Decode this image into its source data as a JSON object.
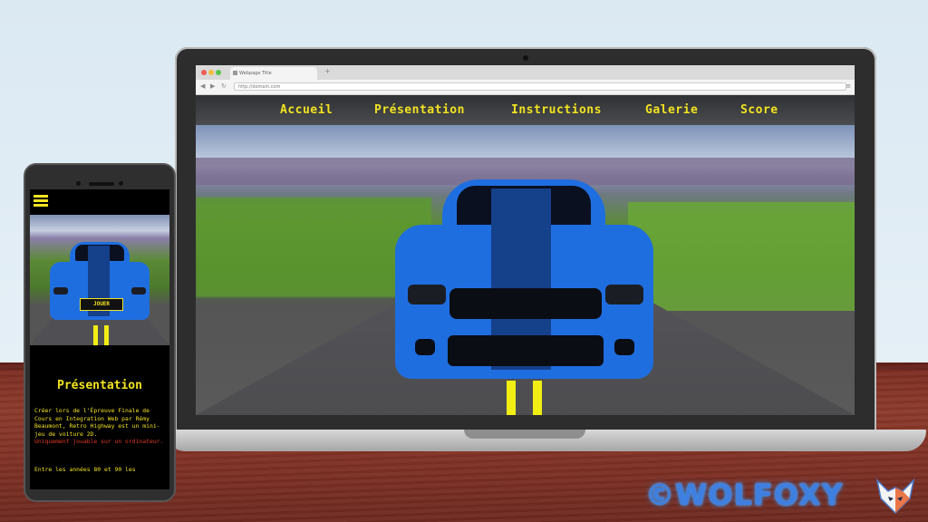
{
  "browser": {
    "tab_title": "Webpage Title",
    "new_tab": "+",
    "url": "http://domain.com",
    "back": "◀",
    "forward": "▶",
    "reload": "↻",
    "menu": "≡"
  },
  "site_nav": {
    "items": [
      {
        "label": "Accueil"
      },
      {
        "label": "Présentation"
      },
      {
        "label": "Instructions"
      },
      {
        "label": "Galerie"
      },
      {
        "label": "Score"
      }
    ],
    "color": "#f2e321"
  },
  "mobile": {
    "play_button": "JOUER",
    "section_title": "Présentation",
    "paragraph": "Créer lors de l'Épreuve Finale de Cours en Integration Web par Rémy Beaumont, Retro Highway est un mini-jeu de voiture 2D.",
    "warning": "Uniquement jouable sur un ordinateur.",
    "paragraph2": "Entre les années 80 et 90 les"
  },
  "watermark": {
    "text": "©WOLFOXY"
  },
  "colors": {
    "accent_yellow": "#f2e321",
    "warning_red": "#e13a24",
    "car_blue": "#1f6ee0",
    "watermark_blue": "#3e7fe0"
  }
}
